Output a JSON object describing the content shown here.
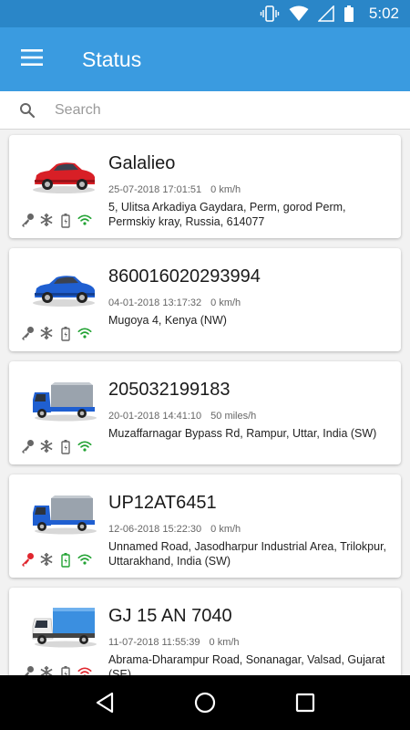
{
  "status_bar": {
    "time": "5:02"
  },
  "app_bar": {
    "title": "Status"
  },
  "search": {
    "placeholder": "Search"
  },
  "vehicles": [
    {
      "name": "Galalieo",
      "datetime": "25-07-2018 17:01:51",
      "speed": "0 km/h",
      "address": "5, Ulitsa Arkadiya Gaydara, Perm, gorod Perm, Permskiy kray, Russia, 614077",
      "type": "red-car-image",
      "status": {
        "ignition": "#666666",
        "ac": "#666666",
        "battery": "#666666",
        "signal": "#22a233"
      }
    },
    {
      "name": "860016020293994",
      "datetime": "04-01-2018 13:17:32",
      "speed": "0 km/h",
      "address": "Mugoya 4, Kenya (NW)",
      "type": "blue-car-image",
      "status": {
        "ignition": "#666666",
        "ac": "#666666",
        "battery": "#666666",
        "signal": "#22a233"
      }
    },
    {
      "name": "205032199183",
      "datetime": "20-01-2018 14:41:10",
      "speed": "50 miles/h",
      "address": "Muzaffarnagar Bypass Rd, Rampur, Uttar,  India (SW)",
      "type": "blue-truck-image",
      "status": {
        "ignition": "#666666",
        "ac": "#666666",
        "battery": "#666666",
        "signal": "#22a233"
      }
    },
    {
      "name": "UP12AT6451",
      "datetime": "12-06-2018 15:22:30",
      "speed": "0 km/h",
      "address": "Unnamed Road, Jasodharpur Industrial Area, Trilokpur, Uttarakhand,  India (SW)",
      "type": "blue-truck-image",
      "status": {
        "ignition": "#e0262e",
        "ac": "#666666",
        "battery": "#22a233",
        "signal": "#22a233"
      }
    },
    {
      "name": "GJ 15 AN 7040",
      "datetime": "11-07-2018 11:55:39",
      "speed": "0 km/h",
      "address": "Abrama-Dharampur Road, Sonanagar, Valsad, Gujarat (SE)",
      "type": "white-blue-truck-image",
      "status": {
        "ignition": "#666666",
        "ac": "#666666",
        "battery": "#666666",
        "signal": "#e0262e"
      }
    }
  ],
  "colors": {
    "status_bar": "#2a86c8",
    "app_bar": "#3a9be0"
  }
}
